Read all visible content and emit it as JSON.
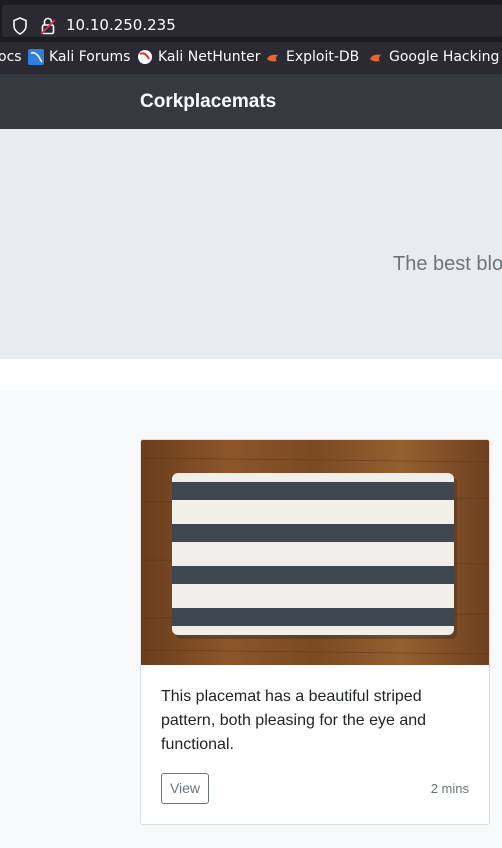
{
  "browser": {
    "url": "10.10.250.235",
    "bookmarks": [
      {
        "label": "ocs",
        "icon": "doc-icon"
      },
      {
        "label": "Kali Forums",
        "icon": "kali-forums-icon"
      },
      {
        "label": "Kali NetHunter",
        "icon": "kali-nethunter-icon"
      },
      {
        "label": "Exploit-DB",
        "icon": "exploit-db-icon"
      },
      {
        "label": "Google Hacking D",
        "icon": "google-hacking-icon"
      }
    ]
  },
  "navbar": {
    "brand": "Corkplacemats"
  },
  "hero": {
    "lead": "The best blo"
  },
  "card": {
    "image_alt": "striped placemat on wooden table",
    "text": "This placemat has a beautiful striped pattern, both pleasing for the eye and functional.",
    "button_label": "View",
    "time": "2 mins"
  },
  "colors": {
    "navbar_bg": "#343a40",
    "hero_bg": "#e9ecef",
    "album_bg": "#f8f9fa",
    "muted_text": "#6c757d"
  }
}
